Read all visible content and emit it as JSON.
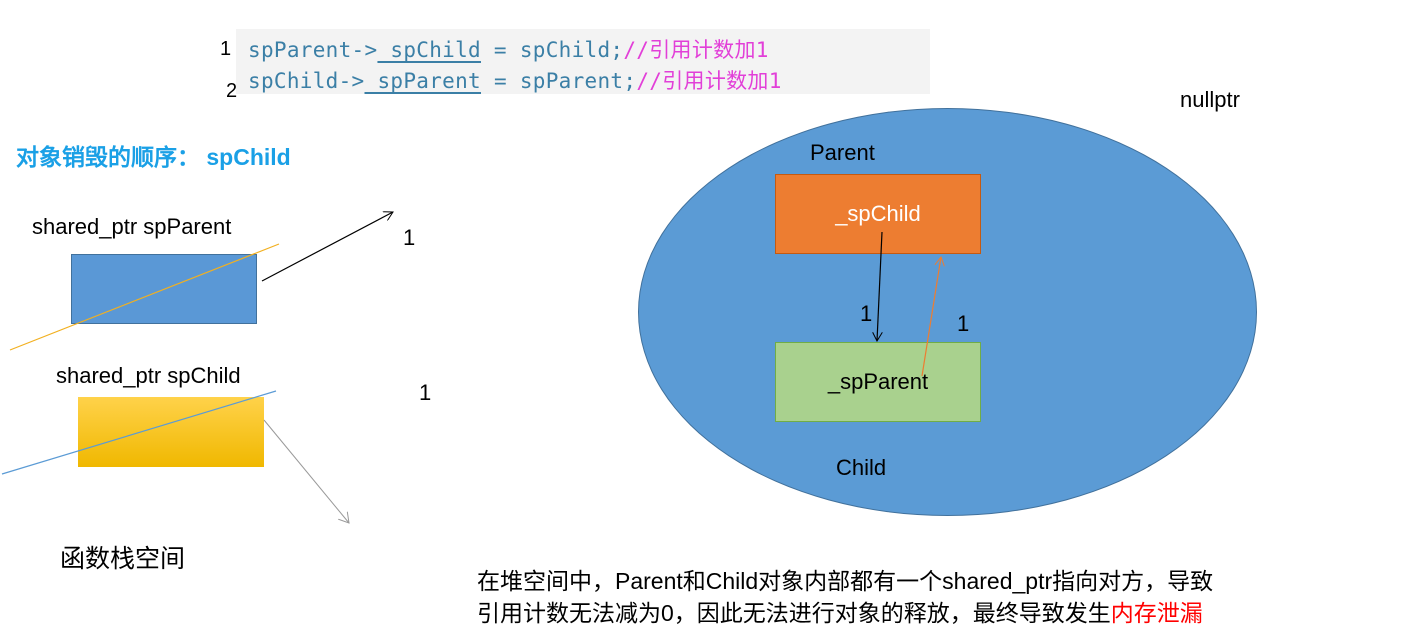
{
  "code": {
    "line1": {
      "number": "1",
      "lhs_prefix": "spParent->",
      "lhs_member": "_spChild",
      "rest": " = spChild;",
      "comment": "//引用计数加1"
    },
    "line2": {
      "number": "2",
      "lhs_prefix": "spChild->",
      "lhs_member": "_spParent",
      "rest": " = spParent;",
      "comment": "//引用计数加1"
    }
  },
  "heading": {
    "label": "对象销毁的顺序：",
    "value": "spChild"
  },
  "stack": {
    "parent_label": "shared_ptr spParent",
    "parent_count": "1",
    "child_label": "shared_ptr  spChild",
    "child_count": "1",
    "caption": "函数栈空间"
  },
  "heap": {
    "nullptr_label": "nullptr",
    "parent_title": "Parent",
    "parent_member": "_spChild",
    "child_title": "Child",
    "child_member": "_spParent",
    "count_left": "1",
    "count_right": "1"
  },
  "explanation": {
    "line1": "在堆空间中，Parent和Child对象内部都有一个shared_ptr指向对方，导致",
    "line2_prefix": "引用计数无法减为0，因此无法进行对象的释放，最终导致发生",
    "line2_highlight": "内存泄漏"
  },
  "colors": {
    "heading": "#1aa0e6",
    "code_text": "#3b7fa6",
    "code_comment": "#e23fd8",
    "heap_ellipse": "#5b9bd5",
    "parent_box": "#ed7d31",
    "child_box": "#a9d18e",
    "stack_parent_box": "#5a98d6",
    "stack_child_box": "#ffc000",
    "highlight": "#ff0000"
  }
}
